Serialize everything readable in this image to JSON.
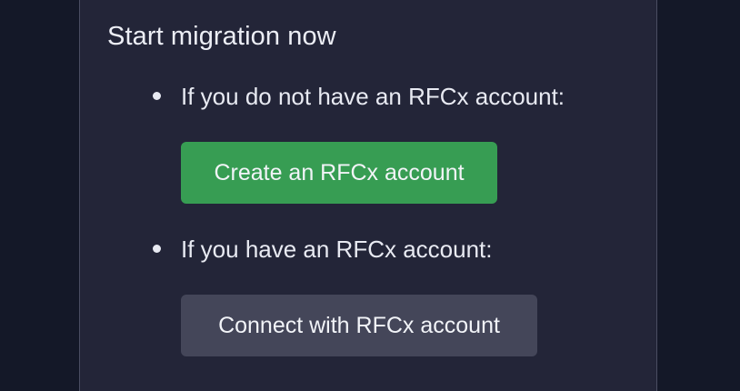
{
  "panel": {
    "title": "Start migration now"
  },
  "options": [
    {
      "text": "If you do not have an RFCx account:",
      "button_label": "Create an RFCx account",
      "button_color": "#379d53"
    },
    {
      "text": "If you have an RFCx account:",
      "button_label": "Connect with RFCx account",
      "button_color": "#444659"
    }
  ],
  "colors": {
    "background": "#141828",
    "panel": "#232538",
    "text": "#e8eaf2"
  }
}
